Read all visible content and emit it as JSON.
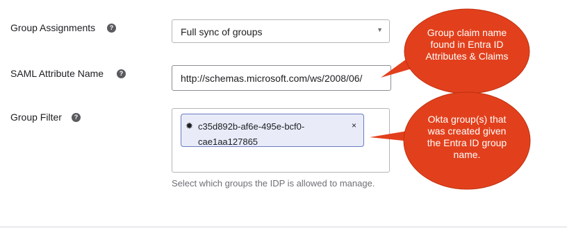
{
  "form": {
    "group_assignments": {
      "label": "Group Assignments",
      "help_icon": "question-circle-icon",
      "selected": "Full sync of groups"
    },
    "saml_attribute": {
      "label": "SAML Attribute Name",
      "help_icon": "question-circle-icon",
      "value": "http://schemas.microsoft.com/ws/2008/06/"
    },
    "group_filter": {
      "label": "Group Filter",
      "help_icon": "question-circle-icon",
      "chip": {
        "icon": "gear-icon",
        "text": "c35d892b-af6e-495e-bcf0-cae1aa127865",
        "remove": "×"
      },
      "hint": "Select which groups the IDP is allowed to manage."
    }
  },
  "callouts": [
    {
      "text": "Group claim name found in Entra ID Attributes & Claims",
      "color": "#e2401c"
    },
    {
      "text": "Okta group(s) that was created given the Entra ID group name.",
      "color": "#e2401c"
    }
  ]
}
